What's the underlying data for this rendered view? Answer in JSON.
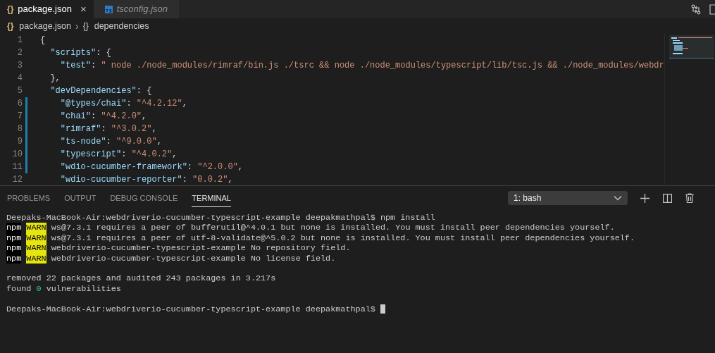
{
  "tabs": [
    {
      "label": "package.json",
      "glyph": "{}",
      "selected": true,
      "preview": false,
      "close": "×"
    },
    {
      "label": "tsconfig.json",
      "selected": false,
      "preview": true
    }
  ],
  "breadcrumb": [
    {
      "glyph": "{}",
      "label": "package.json"
    },
    {
      "glyph": "{}",
      "label": "dependencies"
    }
  ],
  "breadcrumb_separator": "›",
  "code_lines": [
    {
      "number": "1",
      "modified": false,
      "tokens": [
        {
          "kind": "punct",
          "text": "{"
        }
      ]
    },
    {
      "number": "2",
      "modified": false,
      "tokens": [
        {
          "kind": "key",
          "text": "  \"scripts\""
        },
        {
          "kind": "punct",
          "text": ": {"
        }
      ]
    },
    {
      "number": "3",
      "modified": false,
      "tokens": [
        {
          "kind": "key",
          "text": "    \"test\""
        },
        {
          "kind": "punct",
          "text": ": "
        },
        {
          "kind": "string",
          "text": "\" node ./node_modules/rimraf/bin.js ./tsrc && node ./node_modules/typescript/lib/tsc.js && ./node_modules/webdr"
        }
      ]
    },
    {
      "number": "4",
      "modified": false,
      "tokens": [
        {
          "kind": "punct",
          "text": "  },"
        }
      ]
    },
    {
      "number": "5",
      "modified": false,
      "tokens": [
        {
          "kind": "key",
          "text": "  \"devDependencies\""
        },
        {
          "kind": "punct",
          "text": ": {"
        }
      ]
    },
    {
      "number": "6",
      "modified": true,
      "tokens": [
        {
          "kind": "key",
          "text": "    \"@types/chai\""
        },
        {
          "kind": "punct",
          "text": ": "
        },
        {
          "kind": "string",
          "text": "\"^4.2.12\""
        },
        {
          "kind": "punct",
          "text": ","
        }
      ]
    },
    {
      "number": "7",
      "modified": true,
      "tokens": [
        {
          "kind": "key",
          "text": "    \"chai\""
        },
        {
          "kind": "punct",
          "text": ": "
        },
        {
          "kind": "string",
          "text": "\"^4.2.0\""
        },
        {
          "kind": "punct",
          "text": ","
        }
      ]
    },
    {
      "number": "8",
      "modified": true,
      "tokens": [
        {
          "kind": "key",
          "text": "    \"rimraf\""
        },
        {
          "kind": "punct",
          "text": ": "
        },
        {
          "kind": "string",
          "text": "\"^3.0.2\""
        },
        {
          "kind": "punct",
          "text": ","
        }
      ]
    },
    {
      "number": "9",
      "modified": true,
      "tokens": [
        {
          "kind": "key",
          "text": "    \"ts-node\""
        },
        {
          "kind": "punct",
          "text": ": "
        },
        {
          "kind": "string",
          "text": "\"^9.0.0\""
        },
        {
          "kind": "punct",
          "text": ","
        }
      ]
    },
    {
      "number": "10",
      "modified": true,
      "tokens": [
        {
          "kind": "key",
          "text": "    \"typescript\""
        },
        {
          "kind": "punct",
          "text": ": "
        },
        {
          "kind": "string",
          "text": "\"^4.0.2\""
        },
        {
          "kind": "punct",
          "text": ","
        }
      ]
    },
    {
      "number": "11",
      "modified": true,
      "tokens": [
        {
          "kind": "key",
          "text": "    \"wdio-cucumber-framework\""
        },
        {
          "kind": "punct",
          "text": ": "
        },
        {
          "kind": "string",
          "text": "\"^2.0.0\""
        },
        {
          "kind": "punct",
          "text": ","
        }
      ]
    },
    {
      "number": "12",
      "modified": false,
      "tokens": [
        {
          "kind": "key",
          "text": "    \"wdio-cucumber-reporter\""
        },
        {
          "kind": "punct",
          "text": ": "
        },
        {
          "kind": "string",
          "text": "\"0.0.2\""
        },
        {
          "kind": "punct",
          "text": ","
        }
      ]
    }
  ],
  "panel_tabs": [
    {
      "label": "PROBLEMS",
      "selected": false
    },
    {
      "label": "OUTPUT",
      "selected": false
    },
    {
      "label": "DEBUG CONSOLE",
      "selected": false
    },
    {
      "label": "TERMINAL",
      "selected": true
    }
  ],
  "terminal_select": {
    "value": "1: bash"
  },
  "terminal_lines": [
    {
      "segments": [
        {
          "kind": "plain",
          "text": "Deepaks-MacBook-Air:webdriverio-cucumber-typescript-example deepakmathpal$ npm install"
        }
      ]
    },
    {
      "segments": [
        {
          "kind": "npm",
          "text": "npm"
        },
        {
          "kind": "warn",
          "text": "WARN"
        },
        {
          "kind": "plain",
          "text": " ws@7.3.1 requires a peer of bufferutil@^4.0.1 but none is installed. You must install peer dependencies yourself."
        }
      ]
    },
    {
      "segments": [
        {
          "kind": "npm",
          "text": "npm"
        },
        {
          "kind": "warn",
          "text": "WARN"
        },
        {
          "kind": "plain",
          "text": " ws@7.3.1 requires a peer of utf-8-validate@^5.0.2 but none is installed. You must install peer dependencies yourself."
        }
      ]
    },
    {
      "segments": [
        {
          "kind": "npm",
          "text": "npm"
        },
        {
          "kind": "warn",
          "text": "WARN"
        },
        {
          "kind": "plain",
          "text": " webdriverio-cucumber-typescript-example No repository field."
        }
      ]
    },
    {
      "segments": [
        {
          "kind": "npm",
          "text": "npm"
        },
        {
          "kind": "warn",
          "text": "WARN"
        },
        {
          "kind": "plain",
          "text": " webdriverio-cucumber-typescript-example No license field."
        }
      ]
    },
    {
      "gap_before": true,
      "segments": [
        {
          "kind": "plain",
          "text": "removed 22 packages and audited 243 packages in 3.217s"
        }
      ]
    },
    {
      "segments": [
        {
          "kind": "plain",
          "text": "found "
        },
        {
          "kind": "ok",
          "text": "0"
        },
        {
          "kind": "plain",
          "text": " vulnerabilities"
        }
      ]
    },
    {
      "gap_before": true,
      "segments": [
        {
          "kind": "plain",
          "text": "Deepaks-MacBook-Air:webdriverio-cucumber-typescript-example deepakmathpal$ "
        },
        {
          "kind": "cursor"
        }
      ]
    }
  ]
}
